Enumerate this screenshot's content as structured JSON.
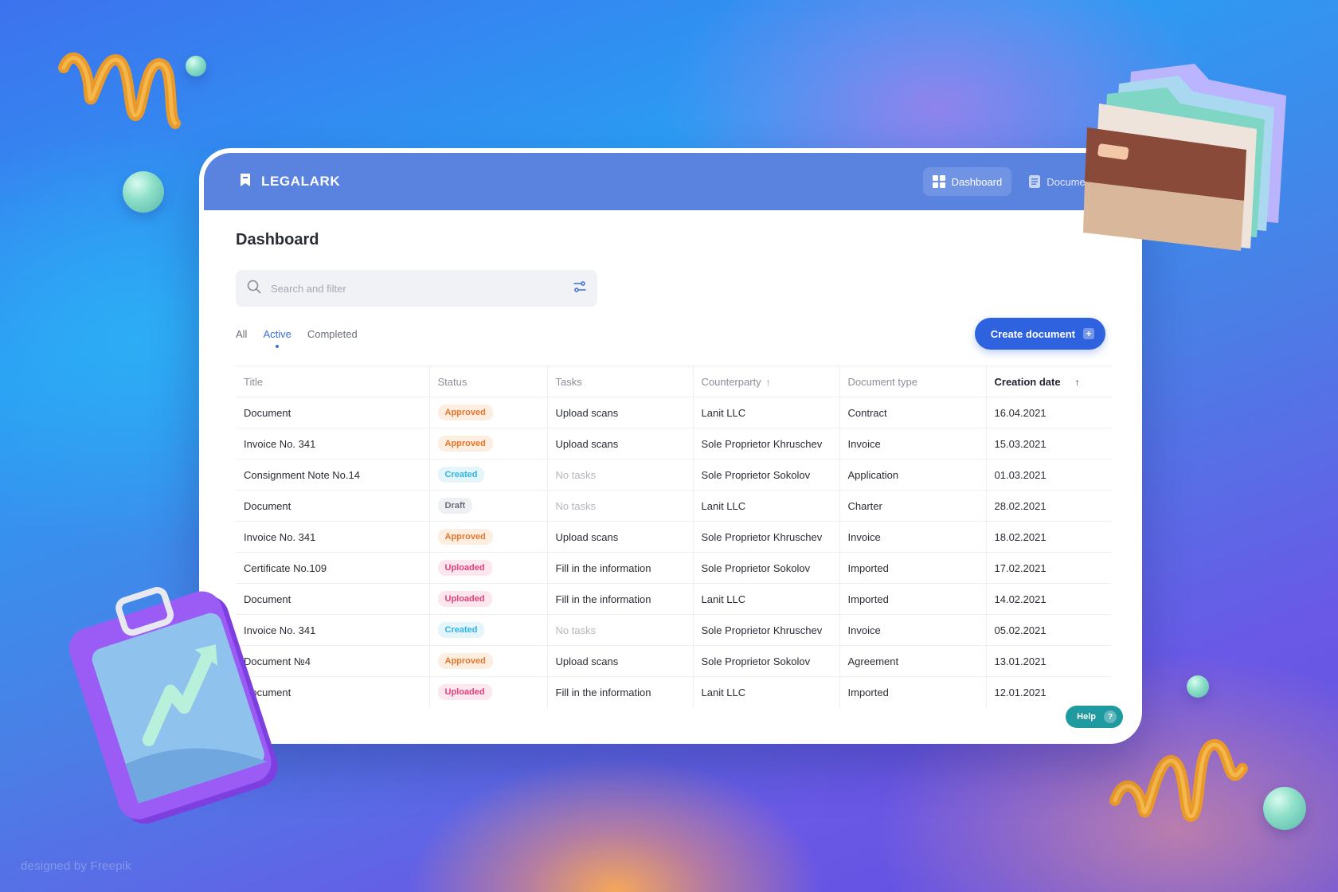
{
  "app": {
    "name": "LEGALARK",
    "logo_icon": "bookmark-logo-icon"
  },
  "nav": {
    "items": [
      {
        "label": "Dashboard",
        "icon": "grid-icon",
        "active": true
      },
      {
        "label": "Documents",
        "icon": "document-list-icon",
        "active": false
      }
    ]
  },
  "page": {
    "title": "Dashboard"
  },
  "search": {
    "placeholder": "Search and filter",
    "value": "",
    "filter_icon": "filter-sliders-icon"
  },
  "tabs": [
    {
      "label": "All",
      "active": false
    },
    {
      "label": "Active",
      "active": true
    },
    {
      "label": "Completed",
      "active": false
    }
  ],
  "create_button": {
    "label": "Create document",
    "icon": "plus-icon"
  },
  "table": {
    "columns": [
      "Title",
      "Status",
      "Tasks",
      "Counterparty",
      "Document type",
      "Creation date"
    ],
    "rows": [
      [
        "Document",
        "Approved",
        "Upload scans",
        "Lanit LLC",
        "Contract",
        "16.04.2021"
      ],
      [
        "Invoice No. 341",
        "Approved",
        "Upload scans",
        "Sole Proprietor Khruschev",
        "Invoice",
        "15.03.2021"
      ],
      [
        "Consignment Note No.14",
        "Created",
        "No tasks",
        "Sole Proprietor Sokolov",
        "Application",
        "01.03.2021"
      ],
      [
        "Document",
        "Draft",
        "No tasks",
        "Lanit LLC",
        "Charter",
        "28.02.2021"
      ],
      [
        "Invoice No. 341",
        "Approved",
        "Upload scans",
        "Sole Proprietor Khruschev",
        "Invoice",
        "18.02.2021"
      ],
      [
        "Certificate No.109",
        "Uploaded",
        "Fill in the information",
        "Sole Proprietor Sokolov",
        "Imported",
        "17.02.2021"
      ],
      [
        "Document",
        "Uploaded",
        "Fill in the information",
        "Lanit LLC",
        "Imported",
        "14.02.2021"
      ],
      [
        "Invoice No. 341",
        "Created",
        "No tasks",
        "Sole Proprietor Khruschev",
        "Invoice",
        "05.02.2021"
      ],
      [
        "Document №4",
        "Approved",
        "Upload scans",
        "Sole Proprietor Sokolov",
        "Agreement",
        "13.01.2021"
      ],
      [
        "Document",
        "Uploaded",
        "Fill in the information",
        "Lanit LLC",
        "Imported",
        "12.01.2021"
      ]
    ]
  },
  "help_button": {
    "label": "Help",
    "icon": "question-icon"
  },
  "watermark": "designed by Freepik",
  "colors": {
    "topbar": "#5a82df",
    "accent": "#2f62de",
    "approved": "#e8752a",
    "created": "#2eb3e6",
    "draft": "#6b6f7a",
    "uploaded": "#e2417c",
    "help": "#1f9aa1"
  }
}
